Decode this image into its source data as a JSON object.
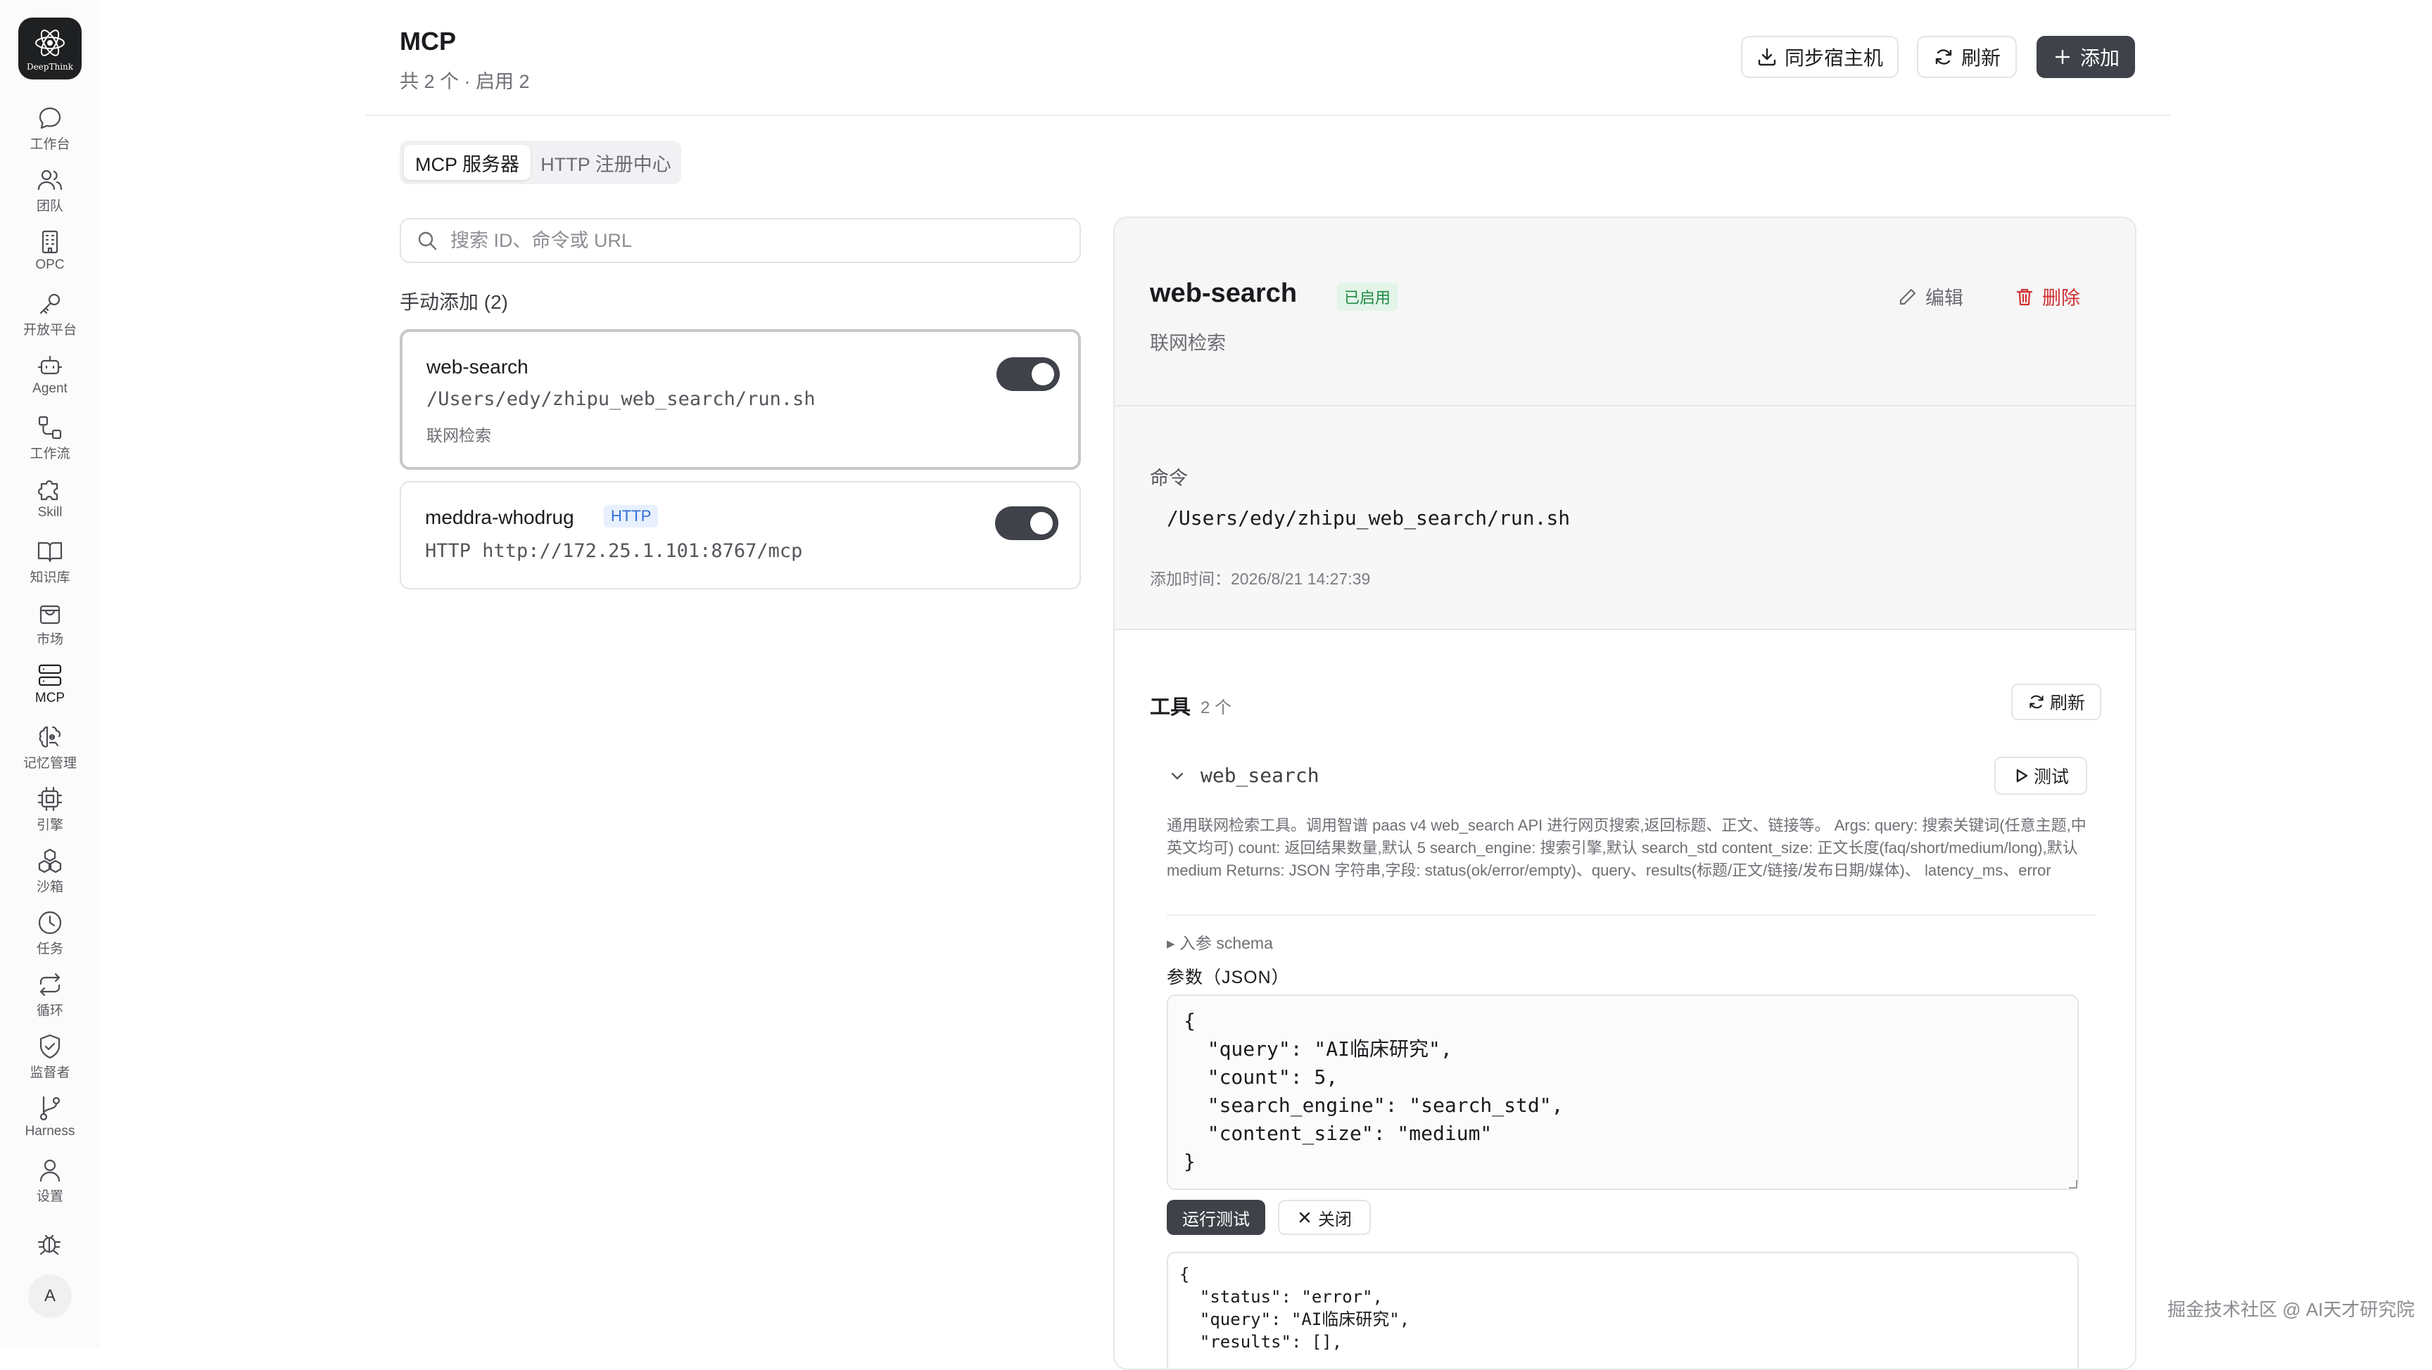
{
  "app": {
    "logo_text": "DeepThink"
  },
  "sidebar": {
    "items": [
      {
        "label": "工作台",
        "icon": "chat-bubble-icon"
      },
      {
        "label": "团队",
        "icon": "users-icon"
      },
      {
        "label": "OPC",
        "icon": "building-icon"
      },
      {
        "label": "开放平台",
        "icon": "key-icon"
      },
      {
        "label": "Agent",
        "icon": "robot-icon"
      },
      {
        "label": "工作流",
        "icon": "workflow-icon"
      },
      {
        "label": "Skill",
        "icon": "puzzle-icon"
      },
      {
        "label": "知识库",
        "icon": "book-icon"
      },
      {
        "label": "市场",
        "icon": "shopping-bag-icon"
      },
      {
        "label": "MCP",
        "icon": "server-icon"
      },
      {
        "label": "记忆管理",
        "icon": "brain-icon"
      },
      {
        "label": "引擎",
        "icon": "cpu-icon"
      },
      {
        "label": "沙箱",
        "icon": "boxes-icon"
      },
      {
        "label": "任务",
        "icon": "clock-icon"
      },
      {
        "label": "循环",
        "icon": "repeat-icon"
      },
      {
        "label": "监督者",
        "icon": "shield-check-icon"
      },
      {
        "label": "Harness",
        "icon": "git-branch-icon"
      },
      {
        "label": "设置",
        "icon": "user-icon"
      }
    ],
    "active": "MCP",
    "avatar_text": "A"
  },
  "header": {
    "title": "MCP",
    "subtitle": "共 2 个 · 启用 2",
    "sync_label": "同步宿主机",
    "refresh_label": "刷新",
    "add_label": "添加"
  },
  "tabs": [
    {
      "label": "MCP 服务器",
      "active": true
    },
    {
      "label": "HTTP 注册中心",
      "active": false
    }
  ],
  "search": {
    "placeholder": "搜索 ID、命令或 URL",
    "value": ""
  },
  "list": {
    "group_title": "手动添加 (2)",
    "servers": [
      {
        "name": "web-search",
        "command": "/Users/edy/zhipu_web_search/run.sh",
        "description": "联网检索",
        "enabled": true,
        "selected": true
      },
      {
        "name": "meddra-whodrug",
        "badge": "HTTP",
        "command": "HTTP http://172.25.1.101:8767/mcp",
        "enabled": true,
        "selected": false
      }
    ]
  },
  "detail": {
    "name": "web-search",
    "status_badge": "已启用",
    "description": "联网检索",
    "edit_label": "编辑",
    "delete_label": "删除",
    "command_label": "命令",
    "command_value": "/Users/edy/zhipu_web_search/run.sh",
    "added_time": "添加时间：2026/8/21 14:27:39",
    "tools": {
      "label": "工具",
      "count": "2 个",
      "refresh_label": "刷新",
      "tool_name": "web_search",
      "test_label": "测试",
      "description": "通用联网检索工具。调用智谱 paas v4 web_search API 进行网页搜索,返回标题、正文、链接等。 Args: query: 搜索关键词(任意主题,中英文均可) count: 返回结果数量,默认 5 search_engine: 搜索引擎,默认 search_std content_size: 正文长度(faq/short/medium/long),默认 medium Returns: JSON 字符串,字段: status(ok/error/empty)、query、results(标题/正文/链接/发布日期/媒体)、 latency_ms、error",
      "schema_toggle": "▸ 入参 schema",
      "params_label": "参数（JSON）",
      "params_json": "{\n  \"query\": \"AI临床研究\",\n  \"count\": 5,\n  \"search_engine\": \"search_std\",\n  \"content_size\": \"medium\"\n}",
      "run_label": "运行测试",
      "close_label": "关闭",
      "result_text": "{\n  \"status\": \"error\",\n  \"query\": \"AI临床研究\",\n  \"results\": [],"
    }
  },
  "watermark": "掘金技术社区 @ AI天才研究院",
  "colors": {
    "accent_dark": "#3f4249",
    "danger": "#d02f2f",
    "success": "#1f8a44",
    "http_badge": "#2f6fd6"
  }
}
